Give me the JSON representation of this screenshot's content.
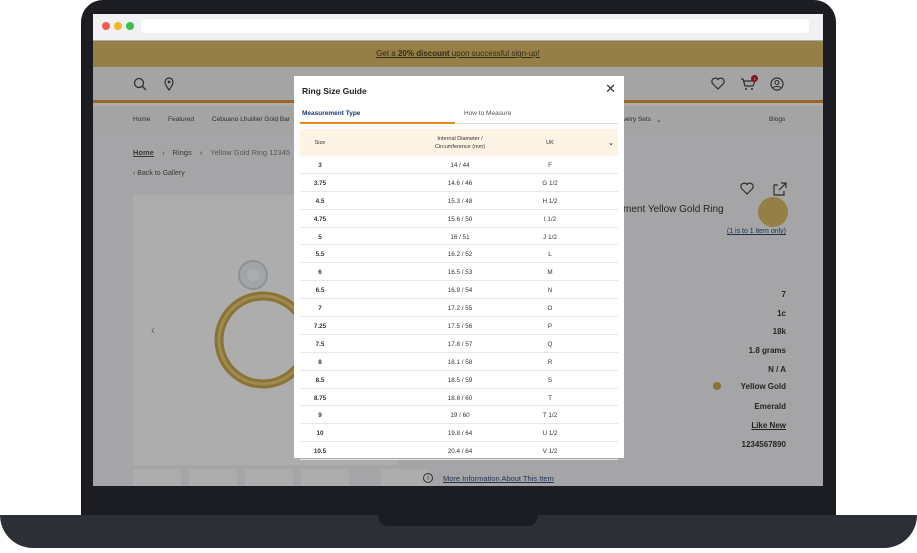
{
  "promo": {
    "prefix": "Get a ",
    "bold": "20% discount",
    "suffix": " upon successful sign-up!"
  },
  "cart_count": "1",
  "nav": {
    "items": [
      "Home",
      "Featured",
      "Cebuano Lhuillier Gold Bar",
      "welry Sets",
      "Blogs"
    ]
  },
  "breadcrumb": {
    "home": "Home",
    "rings": "Rings",
    "current": "Yellow Gold Ring 12345"
  },
  "back_label": "Back to Gallery",
  "product": {
    "title_fragment": "ment Yellow Gold Ring",
    "limit_note": "(1 is to 1 item only)",
    "values": [
      "7",
      "1c",
      "18k",
      "1.8 grams",
      "N / A",
      "Yellow Gold",
      "Emerald",
      "Like New",
      "1234567890"
    ],
    "more_info": "More Information About This Item"
  },
  "modal": {
    "title": "Ring Size Guide",
    "tabs": [
      "Measurement Type",
      "How to Measure"
    ],
    "headers": {
      "size": "Size",
      "diameter_line1": "Internal Diameter /",
      "diameter_line2": "Circumference (mm)",
      "region": "UK"
    },
    "rows": [
      [
        "3",
        "14 / 44",
        "F"
      ],
      [
        "3.75",
        "14.6 / 46",
        "G 1/2"
      ],
      [
        "4.5",
        "15.3 / 48",
        "H 1/2"
      ],
      [
        "4.75",
        "15.6 / 50",
        "I 1/2"
      ],
      [
        "5",
        "16 / 51",
        "J 1/2"
      ],
      [
        "5.5",
        "16.2 / 52",
        "L"
      ],
      [
        "6",
        "16.5 / 53",
        "M"
      ],
      [
        "6.5",
        "16.9 / 54",
        "N"
      ],
      [
        "7",
        "17.2 / 55",
        "O"
      ],
      [
        "7.25",
        "17.5 / 56",
        "P"
      ],
      [
        "7.5",
        "17.8 / 57",
        "Q"
      ],
      [
        "8",
        "18.1 / 58",
        "R"
      ],
      [
        "8.5",
        "18.5 / 59",
        "S"
      ],
      [
        "8.75",
        "18.8 / 60",
        "T"
      ],
      [
        "9",
        "19 / 60",
        "T 1/2"
      ],
      [
        "10",
        "19.8 / 64",
        "U 1/2"
      ],
      [
        "10.5",
        "20.4 / 64",
        "V 1/2"
      ]
    ]
  },
  "colors": {
    "accent": "#e48a21",
    "gold": "#d8b55a",
    "navy": "#1b3a6b",
    "badge": "#d0021b"
  }
}
